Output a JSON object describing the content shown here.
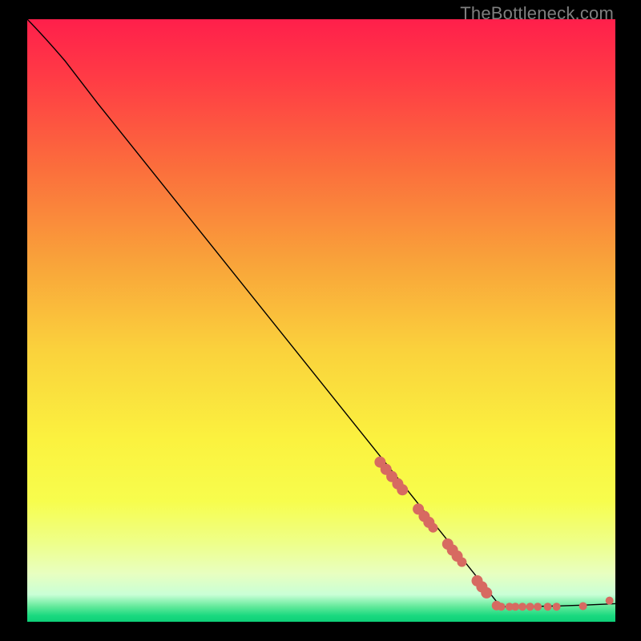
{
  "watermark": "TheBottleneck.com",
  "chart_data": {
    "type": "line",
    "title": "",
    "xlabel": "",
    "ylabel": "",
    "xlim": [
      0,
      100
    ],
    "ylim": [
      0,
      100
    ],
    "background_gradient": {
      "stops": [
        {
          "offset": 0.0,
          "color": "#ff1f4b"
        },
        {
          "offset": 0.1,
          "color": "#ff3c45"
        },
        {
          "offset": 0.25,
          "color": "#fb6f3c"
        },
        {
          "offset": 0.4,
          "color": "#f9a23a"
        },
        {
          "offset": 0.55,
          "color": "#fad23c"
        },
        {
          "offset": 0.7,
          "color": "#fbf23f"
        },
        {
          "offset": 0.8,
          "color": "#f7fd4d"
        },
        {
          "offset": 0.87,
          "color": "#eeff8a"
        },
        {
          "offset": 0.92,
          "color": "#e8ffc0"
        },
        {
          "offset": 0.955,
          "color": "#c9ffd6"
        },
        {
          "offset": 0.975,
          "color": "#61e99a"
        },
        {
          "offset": 0.99,
          "color": "#19d97f"
        },
        {
          "offset": 1.0,
          "color": "#0ecf78"
        }
      ]
    },
    "curve": {
      "note": "values are percent of plot area; y=0 is top, y=100 is bottom",
      "points": [
        {
          "x": 0.0,
          "y": 0.0
        },
        {
          "x": 3.0,
          "y": 3.0
        },
        {
          "x": 6.5,
          "y": 7.0
        },
        {
          "x": 12.0,
          "y": 14.0
        },
        {
          "x": 80.5,
          "y": 97.5
        },
        {
          "x": 100.0,
          "y": 97.0
        }
      ],
      "curvature_hint": "slight ease-out at start, straight to ~x80, then flat"
    },
    "scatter": {
      "color": "#d76a61",
      "radius_small": 5,
      "radius_large": 7,
      "points_pct": [
        {
          "x": 60.0,
          "y": 73.5,
          "r": 7
        },
        {
          "x": 61.0,
          "y": 74.7,
          "r": 7
        },
        {
          "x": 62.0,
          "y": 75.9,
          "r": 7
        },
        {
          "x": 63.0,
          "y": 77.1,
          "r": 7
        },
        {
          "x": 63.8,
          "y": 78.1,
          "r": 7
        },
        {
          "x": 66.5,
          "y": 81.3,
          "r": 7
        },
        {
          "x": 67.5,
          "y": 82.5,
          "r": 7
        },
        {
          "x": 68.3,
          "y": 83.5,
          "r": 7
        },
        {
          "x": 69.0,
          "y": 84.4,
          "r": 6
        },
        {
          "x": 71.5,
          "y": 87.1,
          "r": 7
        },
        {
          "x": 72.3,
          "y": 88.1,
          "r": 7
        },
        {
          "x": 73.1,
          "y": 89.1,
          "r": 7
        },
        {
          "x": 73.9,
          "y": 90.1,
          "r": 6
        },
        {
          "x": 76.5,
          "y": 93.2,
          "r": 7
        },
        {
          "x": 77.3,
          "y": 94.2,
          "r": 7
        },
        {
          "x": 78.1,
          "y": 95.2,
          "r": 7
        },
        {
          "x": 79.8,
          "y": 97.3,
          "r": 6
        },
        {
          "x": 80.6,
          "y": 97.5,
          "r": 5
        },
        {
          "x": 82.0,
          "y": 97.5,
          "r": 5
        },
        {
          "x": 83.0,
          "y": 97.5,
          "r": 5
        },
        {
          "x": 84.2,
          "y": 97.5,
          "r": 5
        },
        {
          "x": 85.5,
          "y": 97.5,
          "r": 5
        },
        {
          "x": 86.8,
          "y": 97.5,
          "r": 5
        },
        {
          "x": 88.5,
          "y": 97.5,
          "r": 5
        },
        {
          "x": 90.0,
          "y": 97.5,
          "r": 5
        },
        {
          "x": 94.5,
          "y": 97.4,
          "r": 5
        },
        {
          "x": 99.0,
          "y": 96.5,
          "r": 5
        }
      ]
    }
  }
}
